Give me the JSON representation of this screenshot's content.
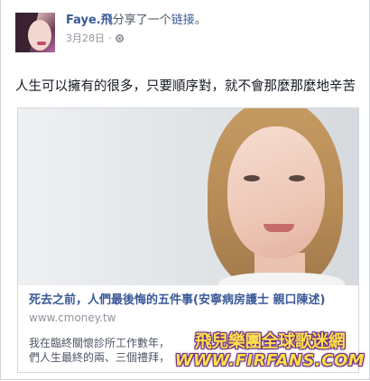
{
  "post": {
    "author": "Faye.飛",
    "action": "分享了一个",
    "link_word": "链接",
    "punct": "。",
    "date": "3月28日",
    "privacy_icon": "globe-icon",
    "message": "人生可以擁有的很多，只要順序對，就不會那麼那麼地辛苦"
  },
  "shared_link": {
    "title": "死去之前，人們最後悔的五件事(安寧病房護士 親口陳述)",
    "domain": "www.cmoney.tw",
    "description_lines": [
      "我在臨終關懷診所工作數年，",
      "們人生最終的兩、三個禮拜，"
    ]
  },
  "watermark": {
    "cn": "飛兒樂團全球歌迷網",
    "en": "WWW.FIRFANS.COM"
  },
  "colors": {
    "link_blue": "#3b5998",
    "meta_gray": "#90949c",
    "watermark_yellow": "#ffe04a",
    "watermark_outline": "#6a2a8a"
  }
}
